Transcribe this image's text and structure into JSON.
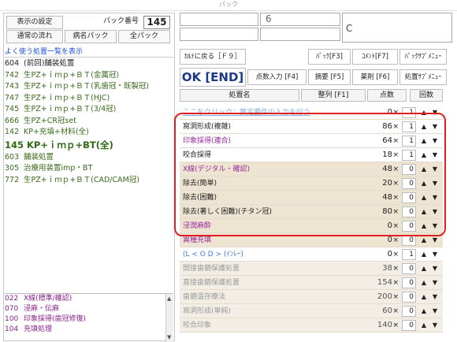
{
  "window": {
    "title": "パック"
  },
  "left": {
    "settings_btn": "表示の設定",
    "pack_number_label": "パック番号",
    "pack_number": "145",
    "normal_flow_btn": "通常の流れ",
    "disease_pack_btn": "病名パック",
    "all_pack_btn": "全パック",
    "favorites_header": "よく使う処置一覧を表示",
    "favorites": [
      {
        "code": "604",
        "name": "(前回)舗装処置",
        "style": "black"
      },
      {
        "code": "742",
        "name": "生PZ+ｉｍｐ+ＢＴ(金属冠)",
        "style": "green"
      },
      {
        "code": "743",
        "name": "生PZ+ｉｍｐ+ＢＴ(乳歯冠・既製冠)",
        "style": "green"
      },
      {
        "code": "747",
        "name": "生PZ+ｉｍｐ+ＢＴ(HJC)",
        "style": "green"
      },
      {
        "code": "745",
        "name": "生PZ+ｉｍｐ+ＢＴ(3/4冠)",
        "style": "green"
      },
      {
        "code": "666",
        "name": "生PZ+CR冠set",
        "style": "green"
      },
      {
        "code": "142",
        "name": "KP+充填+材料(全)",
        "style": "green"
      },
      {
        "code": "145",
        "name": "KP+ｉｍｐ+BT(全)",
        "style": "big"
      },
      {
        "code": "603",
        "name": "舗装処置",
        "style": "green"
      },
      {
        "code": "305",
        "name": "治療用装置imp・BT",
        "style": "green"
      },
      {
        "code": "772",
        "name": "生PZ+ｉｍｐ+ＢＴ(CAD/CAM冠)",
        "style": "green"
      }
    ],
    "bottom_list": [
      {
        "code": "022",
        "name": "X線(標準/確認)"
      },
      {
        "code": "070",
        "name": "浸麻・伝麻"
      },
      {
        "code": "100",
        "name": "印象採得(歯冠修復)"
      },
      {
        "code": "104",
        "name": "充填処理"
      }
    ]
  },
  "right": {
    "top_field_value": "6",
    "top_field_c": "C",
    "buttons": {
      "back_to_chart": "ｶﾙﾃに戻る［Ｆ９］",
      "pack": "ﾊﾟｯｸ[F3]",
      "comment": "ｺﾒﾝﾄ[F7]",
      "pack_submenu": "ﾊﾟｯｸｻﾌﾞﾒﾆｭｰ",
      "ok_end": "OK [END]",
      "points_input": "点数入力 [F4]",
      "summary": "摘要 [F5]",
      "medication": "薬剤 [F6]",
      "procedure_submenu": "処置ｻﾌﾞﾒﾆｭｰ"
    },
    "headers": {
      "procedure_name": "処置名",
      "sort": "整列 [F1]",
      "points": "点数",
      "count": "回数"
    },
    "rows": [
      {
        "name": "ここをクリック：算定要件の入力を行う",
        "points": "0",
        "count": "1",
        "style": "link"
      },
      {
        "name": "窩洞形成(複雑)",
        "points": "86",
        "count": "1",
        "style": "white"
      },
      {
        "name": "印象採得(連合)",
        "points": "64",
        "count": "1",
        "style": "purple"
      },
      {
        "name": "咬合採得",
        "points": "18",
        "count": "1",
        "style": "white"
      },
      {
        "name": "X線(デジタル・確認)",
        "points": "48",
        "count": "0",
        "style": "purpletan"
      },
      {
        "name": "除去(簡単)",
        "points": "20",
        "count": "0",
        "style": "tan"
      },
      {
        "name": "除去(困難)",
        "points": "48",
        "count": "0",
        "style": "tan"
      },
      {
        "name": "除去(著しく困難)(チタン冠)",
        "points": "80",
        "count": "0",
        "style": "tan"
      },
      {
        "name": "浸潤麻酔",
        "points": "0",
        "count": "0",
        "style": "purpletan"
      },
      {
        "name": "異種充填",
        "points": "0",
        "count": "0",
        "style": "purpletan"
      },
      {
        "name": "(L < O D > (ｲﾝﾚｰ)",
        "points": "0",
        "count": "1",
        "style": "bluewhite"
      },
      {
        "name": "間接歯髄保護処置",
        "points": "38",
        "count": "0",
        "style": "grey"
      },
      {
        "name": "直接歯髄保護処置",
        "points": "154",
        "count": "0",
        "style": "grey"
      },
      {
        "name": "歯髄温存療法",
        "points": "200",
        "count": "0",
        "style": "grey"
      },
      {
        "name": "窩洞形成(単純)",
        "points": "60",
        "count": "0",
        "style": "grey"
      },
      {
        "name": "咬合印象",
        "points": "140",
        "count": "0",
        "style": "grey"
      }
    ],
    "multiply_sign": "×",
    "up_arrow": "▲",
    "down_arrow": "▼"
  },
  "icons": [
    "scroll-up-icon",
    "scroll-down-icon",
    "increment-icon",
    "decrement-icon"
  ]
}
